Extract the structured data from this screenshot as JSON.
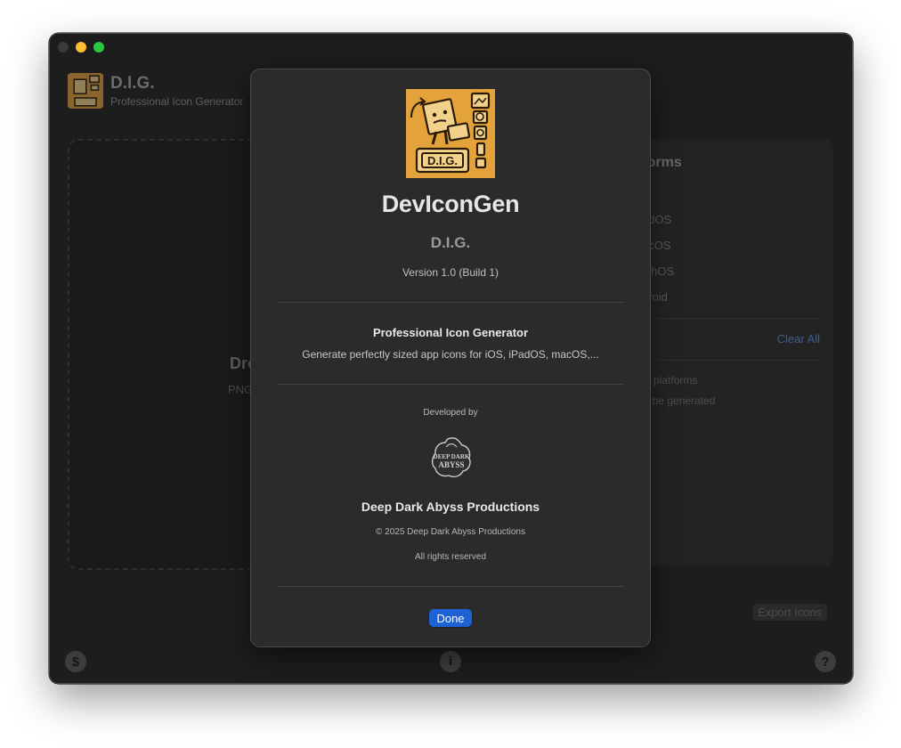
{
  "window": {
    "controls": [
      "close",
      "minimize",
      "zoom"
    ]
  },
  "app": {
    "title": "D.I.G.",
    "subtitle": "Professional Icon Generator"
  },
  "dropzone": {
    "title_partial": "Dro",
    "subtitle_partial": "PNG"
  },
  "platforms": {
    "title_partial": "tforms",
    "section_partial": "s",
    "items": [
      "adOS",
      "acOS",
      "tchOS",
      "droid"
    ],
    "clear_all": "Clear All",
    "info_line_1": "0 platforms",
    "info_line_2": "ll be generated"
  },
  "export": {
    "label": "Export Icons"
  },
  "bottom_bar": {
    "left_icon": "dollar-icon",
    "left_glyph": "$",
    "center_icon": "info-icon",
    "center_glyph": "i",
    "right_icon": "help-icon",
    "right_glyph": "?"
  },
  "about": {
    "app_name": "DevIconGen",
    "abbr": "D.I.G.",
    "version": "Version 1.0 (Build 1)",
    "heading": "Professional Icon Generator",
    "description": "Generate perfectly sized app icons for iOS, iPadOS, macOS,...",
    "developed_by": "Developed by",
    "dev_logo_text": "DEEP DARK ABYSS",
    "company": "Deep Dark Abyss Productions",
    "copyright": "© 2025 Deep Dark Abyss Productions",
    "rights": "All rights reserved",
    "done": "Done",
    "icon_text": "D.I.G."
  },
  "colors": {
    "accent": "#1d62d6",
    "icon_bg": "#e3a33a",
    "window_bg": "#1d1d1d",
    "sheet_bg": "#2b2b2b"
  }
}
